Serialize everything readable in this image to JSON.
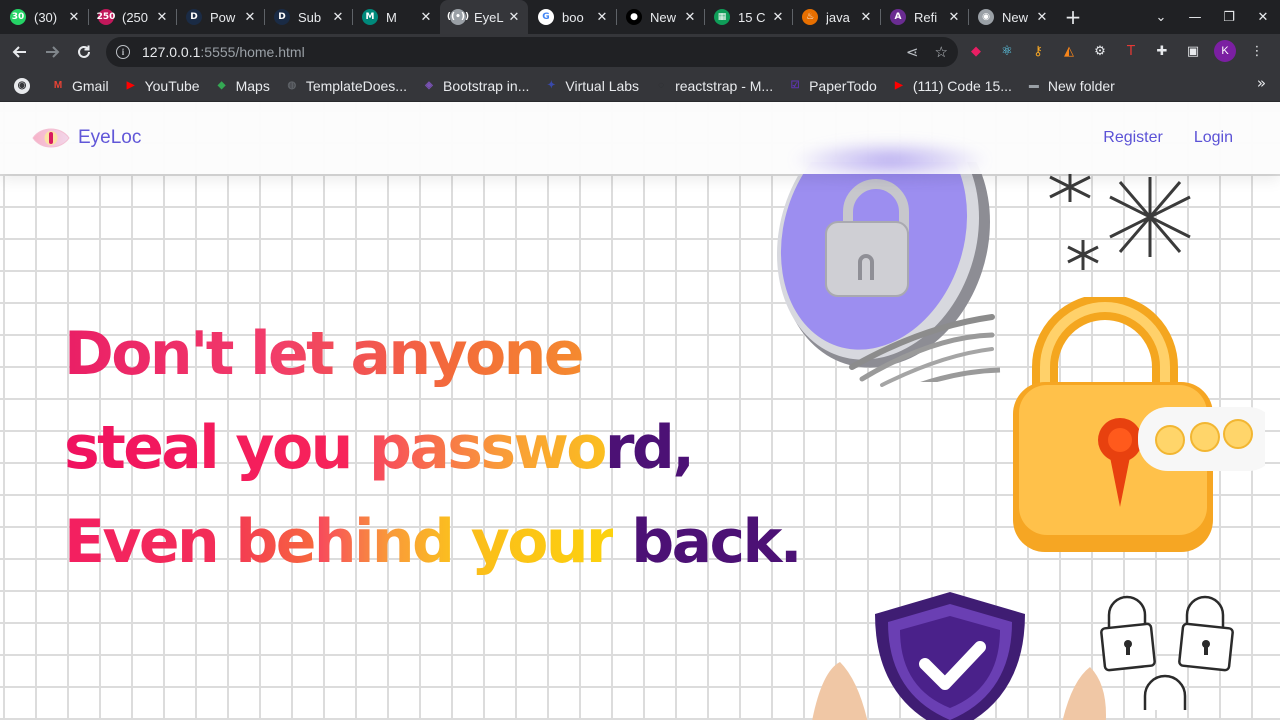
{
  "browser": {
    "tabs": [
      {
        "title": "(30)",
        "icon": "whatsapp-icon",
        "color": "#25d366",
        "glyph": "30"
      },
      {
        "title": "(250",
        "icon": "app-badge-icon",
        "color": "#c2185b",
        "glyph": "250"
      },
      {
        "title": "Pow",
        "icon": "d-logo-icon",
        "color": "#1a2b45",
        "glyph": "D"
      },
      {
        "title": "Sub",
        "icon": "d-logo-icon",
        "color": "#1a2b45",
        "glyph": "D"
      },
      {
        "title": "M",
        "icon": "google-meet-icon",
        "color": "#00897b",
        "glyph": "M"
      },
      {
        "title": "EyeL",
        "icon": "broadcast-icon",
        "color": "#9aa0a6",
        "glyph": "((•))"
      },
      {
        "title": "boo",
        "icon": "google-icon",
        "color": "#ffffff",
        "glyph": "G"
      },
      {
        "title": "New",
        "icon": "github-icon",
        "color": "#000000",
        "glyph": "●"
      },
      {
        "title": "15 C",
        "icon": "sheets-icon",
        "color": "#0f9d58",
        "glyph": "▦"
      },
      {
        "title": "java",
        "icon": "java-icon",
        "color": "#e76f00",
        "glyph": "♨"
      },
      {
        "title": "Refi",
        "icon": "angular-icon",
        "color": "#6a2c91",
        "glyph": "A"
      },
      {
        "title": "New",
        "icon": "chrome-icon",
        "color": "#9aa0a6",
        "glyph": "◉"
      }
    ],
    "active_tab": 5,
    "url_host": "127.0.0.1",
    "url_rest": ":5555/home.html",
    "profile_initial": "K",
    "bookmarks": [
      {
        "label": "Gmail",
        "icon": "gmail-icon",
        "color": "#ea4335",
        "glyph": "M"
      },
      {
        "label": "YouTube",
        "icon": "youtube-icon",
        "color": "#ff0000",
        "glyph": "▶"
      },
      {
        "label": "Maps",
        "icon": "maps-icon",
        "color": "#34a853",
        "glyph": "◆"
      },
      {
        "label": "TemplateDoes...",
        "icon": "globe-icon",
        "color": "#5f6368",
        "glyph": "◍"
      },
      {
        "label": "Bootstrap in...",
        "icon": "bootstrap-icon",
        "color": "#7952b3",
        "glyph": "◈"
      },
      {
        "label": "Virtual Labs",
        "icon": "virtual-labs-icon",
        "color": "#3949ab",
        "glyph": "✦"
      },
      {
        "label": "reactstrap - M...",
        "icon": "reactstrap-icon",
        "color": "#2d2e31",
        "glyph": "◌"
      },
      {
        "label": "PaperTodo",
        "icon": "papertodo-icon",
        "color": "#5e35b1",
        "glyph": "☑"
      },
      {
        "label": "(111) Code 15...",
        "icon": "youtube-icon",
        "color": "#ff0000",
        "glyph": "▶"
      },
      {
        "label": "New folder",
        "icon": "folder-icon",
        "color": "#9aa0a6",
        "glyph": "▬"
      }
    ]
  },
  "site": {
    "brand": "EyeLoc",
    "nav": {
      "register": "Register",
      "login": "Login"
    },
    "hero": {
      "line1": "Don't let anyone",
      "line2a": "steal you",
      "line2b": "passwo",
      "line2c": "rd,",
      "line3a": "Even be",
      "line3b": "hind",
      "line3c": "your",
      "line3d": "back."
    }
  }
}
